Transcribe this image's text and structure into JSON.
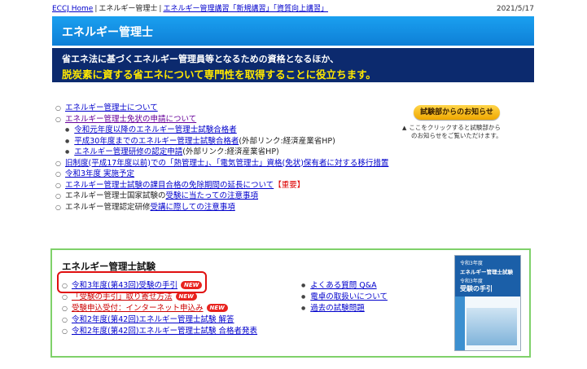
{
  "topbar": {
    "home": "ECCJ Home",
    "current": "エネルギー管理士",
    "seminar": "エネルギー管理講習「新規講習」「資質向上講習」",
    "date": "2021/5/17"
  },
  "header": {
    "title": "エネルギー管理士"
  },
  "banner": {
    "line1": "省エネ法に基づくエネルギー管理員等となるための資格となるほか、",
    "line2": "脱炭素に資する省エネについて専門性を取得することに役立ちます。"
  },
  "links": {
    "about": "エネルギー管理士について",
    "license": "エネルギー管理士免状の申請について",
    "license_sub": [
      "令和元年度以降のエネルギー管理士試験合格者",
      "平成30年度までのエネルギー管理士試験合格者",
      "エネルギー管理研修の認定申請"
    ],
    "external": "(外部リンク:経済産業省HP)",
    "transition": "旧制度(平成17年度以前)での「熱管理士」、「電気管理士」資格(免状)保有者に対する移行措置",
    "schedule": "令和3年度 実施予定",
    "extension": "エネルギー管理士試験の課目合格の免除期間の延長について",
    "important": "【重要】",
    "exam_notice_prefix": "エネルギー管理士国家試験の",
    "exam_notice_link": "受験に当たっての注意事項",
    "training_notice_prefix": "エネルギー管理認定研修",
    "training_notice_link": "受講に際しての注意事項"
  },
  "notice": {
    "button": "試験部からのお知らせ",
    "desc1": "ここをクリックすると試験部から",
    "desc2": "のお知らせをご覧いただけます。"
  },
  "exam": {
    "title": "エネルギー管理士試験",
    "left_items": [
      "令和3年度(第43回)受験の手引",
      "「受験の手引」取り寄せ方法",
      "受験申込受付：インターネット申込み",
      "令和2年度(第42回)エネルギー管理士試験 解答",
      "令和2年度(第42回)エネルギー管理士試験 合格者発表"
    ],
    "new_badge": "NEW",
    "right_items": [
      "よくある質問 Q&A",
      "電卓の取扱いについて",
      "過去の試験問題"
    ]
  },
  "cover": {
    "line1": "令和3年度",
    "line2": "エネルギー管理士試験",
    "line3": "令和3年度",
    "line4": "受験の手引"
  }
}
